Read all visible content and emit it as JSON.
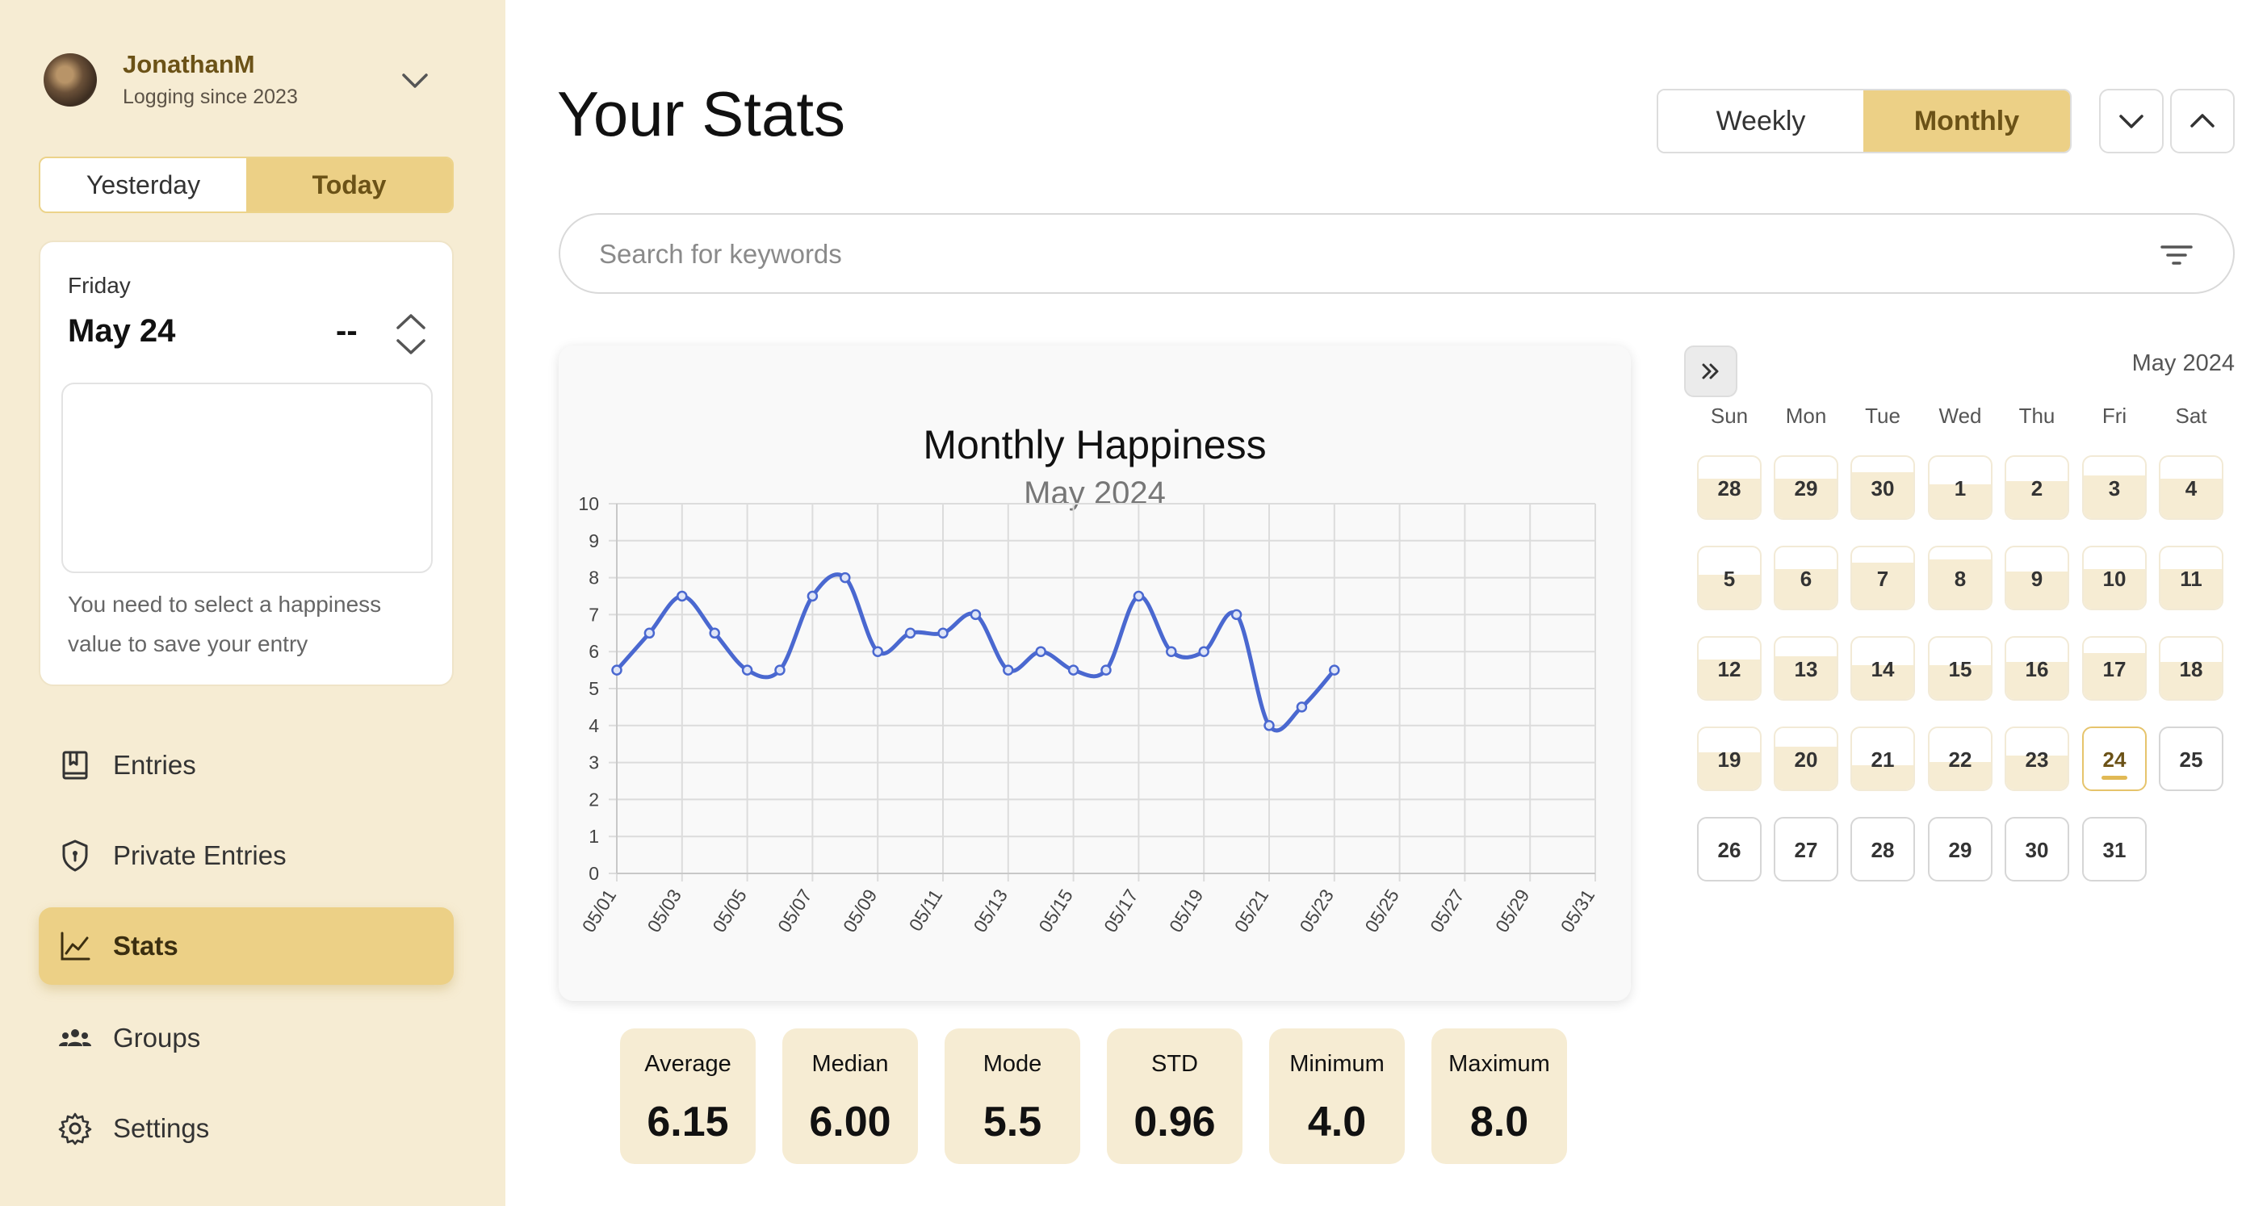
{
  "sidebar": {
    "user": {
      "name": "JonathanM",
      "subtitle": "Logging since 2023"
    },
    "day_toggle": {
      "yesterday": "Yesterday",
      "today": "Today",
      "selected": "Today"
    },
    "entry": {
      "weekday": "Friday",
      "date": "May 24",
      "value": "--",
      "text": "",
      "hint": "You need to select a happiness value to save your entry"
    },
    "nav": [
      {
        "label": "Entries",
        "icon": "journal-icon",
        "active": false
      },
      {
        "label": "Private Entries",
        "icon": "shield-icon",
        "active": false
      },
      {
        "label": "Stats",
        "icon": "line-chart-icon",
        "active": true
      },
      {
        "label": "Groups",
        "icon": "groups-icon",
        "active": false
      },
      {
        "label": "Settings",
        "icon": "gear-icon",
        "active": false
      }
    ]
  },
  "main": {
    "title": "Your Stats",
    "period": {
      "weekly": "Weekly",
      "monthly": "Monthly",
      "selected": "Monthly"
    },
    "search": {
      "placeholder": "Search for keywords",
      "value": ""
    },
    "stats": [
      {
        "label": "Average",
        "value": "6.15"
      },
      {
        "label": "Median",
        "value": "6.00"
      },
      {
        "label": "Mode",
        "value": "5.5"
      },
      {
        "label": "STD",
        "value": "0.96"
      },
      {
        "label": "Minimum",
        "value": "4.0"
      },
      {
        "label": "Maximum",
        "value": "8.0"
      }
    ]
  },
  "calendar": {
    "month_label": "May 2024",
    "weekdays": [
      "Sun",
      "Mon",
      "Tue",
      "Wed",
      "Thu",
      "Fri",
      "Sat"
    ],
    "today": 24,
    "days": [
      {
        "label": "28",
        "level": 0.65
      },
      {
        "label": "29",
        "level": 0.65
      },
      {
        "label": "30",
        "level": 0.75
      },
      {
        "label": "1",
        "level": 0.55
      },
      {
        "label": "2",
        "level": 0.6
      },
      {
        "label": "3",
        "level": 0.7
      },
      {
        "label": "4",
        "level": 0.65
      },
      {
        "label": "5",
        "level": 0.55
      },
      {
        "label": "6",
        "level": 0.65
      },
      {
        "label": "7",
        "level": 0.75
      },
      {
        "label": "8",
        "level": 0.8
      },
      {
        "label": "9",
        "level": 0.6
      },
      {
        "label": "10",
        "level": 0.65
      },
      {
        "label": "11",
        "level": 0.65
      },
      {
        "label": "12",
        "level": 0.65
      },
      {
        "label": "13",
        "level": 0.7
      },
      {
        "label": "14",
        "level": 0.55
      },
      {
        "label": "15",
        "level": 0.55
      },
      {
        "label": "16",
        "level": 0.6
      },
      {
        "label": "17",
        "level": 0.75
      },
      {
        "label": "18",
        "level": 0.6
      },
      {
        "label": "19",
        "level": 0.6
      },
      {
        "label": "20",
        "level": 0.7
      },
      {
        "label": "21",
        "level": 0.4
      },
      {
        "label": "22",
        "level": 0.45
      },
      {
        "label": "23",
        "level": 0.55
      },
      {
        "label": "24",
        "level": 0
      },
      {
        "label": "25",
        "level": 0
      },
      {
        "label": "26",
        "level": 0
      },
      {
        "label": "27",
        "level": 0
      },
      {
        "label": "28",
        "level": 0
      },
      {
        "label": "29",
        "level": 0
      },
      {
        "label": "30",
        "level": 0
      },
      {
        "label": "31",
        "level": 0
      }
    ]
  },
  "chart_data": {
    "type": "line",
    "title": "Monthly Happiness",
    "subtitle": "May 2024",
    "xlabel": "",
    "ylabel": "",
    "ylim": [
      0,
      10
    ],
    "yticks": [
      0,
      1,
      2,
      3,
      4,
      5,
      6,
      7,
      8,
      9,
      10
    ],
    "xticks": [
      "05/01",
      "05/03",
      "05/05",
      "05/07",
      "05/09",
      "05/11",
      "05/13",
      "05/15",
      "05/17",
      "05/19",
      "05/21",
      "05/23",
      "05/25",
      "05/27",
      "05/29",
      "05/31"
    ],
    "grid": true,
    "color": "#4a68d0",
    "series": [
      {
        "x": [
          "05/01",
          "05/02",
          "05/03",
          "05/04",
          "05/05",
          "05/06",
          "05/07",
          "05/08",
          "05/09",
          "05/10",
          "05/11",
          "05/12",
          "05/13",
          "05/14",
          "05/15",
          "05/16",
          "05/17",
          "05/18",
          "05/19",
          "05/20",
          "05/21",
          "05/22",
          "05/23"
        ],
        "values": [
          5.5,
          6.5,
          7.5,
          6.5,
          5.5,
          5.5,
          7.5,
          8.0,
          6.0,
          6.5,
          6.5,
          7.0,
          5.5,
          6.0,
          5.5,
          5.5,
          7.5,
          6.0,
          6.0,
          7.0,
          4.0,
          4.5,
          5.5
        ]
      }
    ]
  }
}
